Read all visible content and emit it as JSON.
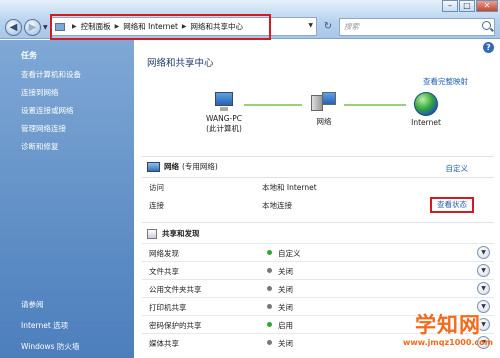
{
  "address_bar": {
    "breadcrumbs": [
      "控制面板",
      "网络和 Internet",
      "网络和共享中心"
    ]
  },
  "search": {
    "placeholder": "搜索"
  },
  "window_buttons": {
    "minimize": "–",
    "maximize": "□",
    "close": "✕"
  },
  "sidebar": {
    "heading": "任务",
    "items": [
      "查看计算机和设备",
      "连接到网络",
      "设置连接或网络",
      "管理网络连接",
      "诊断和修复"
    ],
    "see_also": {
      "heading": "请参阅",
      "items": [
        "Internet 选项",
        "Windows 防火墙"
      ]
    }
  },
  "main": {
    "title": "网络和共享中心",
    "view_full_map": "查看完整映射",
    "map": {
      "computer": {
        "name": "WANG-PC",
        "sub": "(此计算机)"
      },
      "network": {
        "name": "网络"
      },
      "internet": {
        "name": "Internet"
      }
    },
    "network": {
      "name": "网络",
      "type": "(专用网络)",
      "customize": "自定义",
      "access_label": "访问",
      "access_value": "本地和 Internet",
      "connection_label": "连接",
      "connection_value": "本地连接",
      "view_status": "查看状态"
    },
    "sharing": {
      "heading": "共享和发现",
      "rows": [
        {
          "label": "网络发现",
          "value": "自定义",
          "on": true
        },
        {
          "label": "文件共享",
          "value": "关闭",
          "on": false
        },
        {
          "label": "公用文件夹共享",
          "value": "关闭",
          "on": false
        },
        {
          "label": "打印机共享",
          "value": "关闭",
          "on": false
        },
        {
          "label": "密码保护的共享",
          "value": "启用",
          "on": true
        },
        {
          "label": "媒体共享",
          "value": "关闭",
          "on": false
        }
      ]
    }
  },
  "watermark": {
    "main": "学知网",
    "url": "www.jmqz1000.com"
  },
  "colors": {
    "highlight": "#d41a21",
    "link": "#1f5eb3",
    "sidebar": "#5f8ec5",
    "watermark": "#f36a1b"
  }
}
